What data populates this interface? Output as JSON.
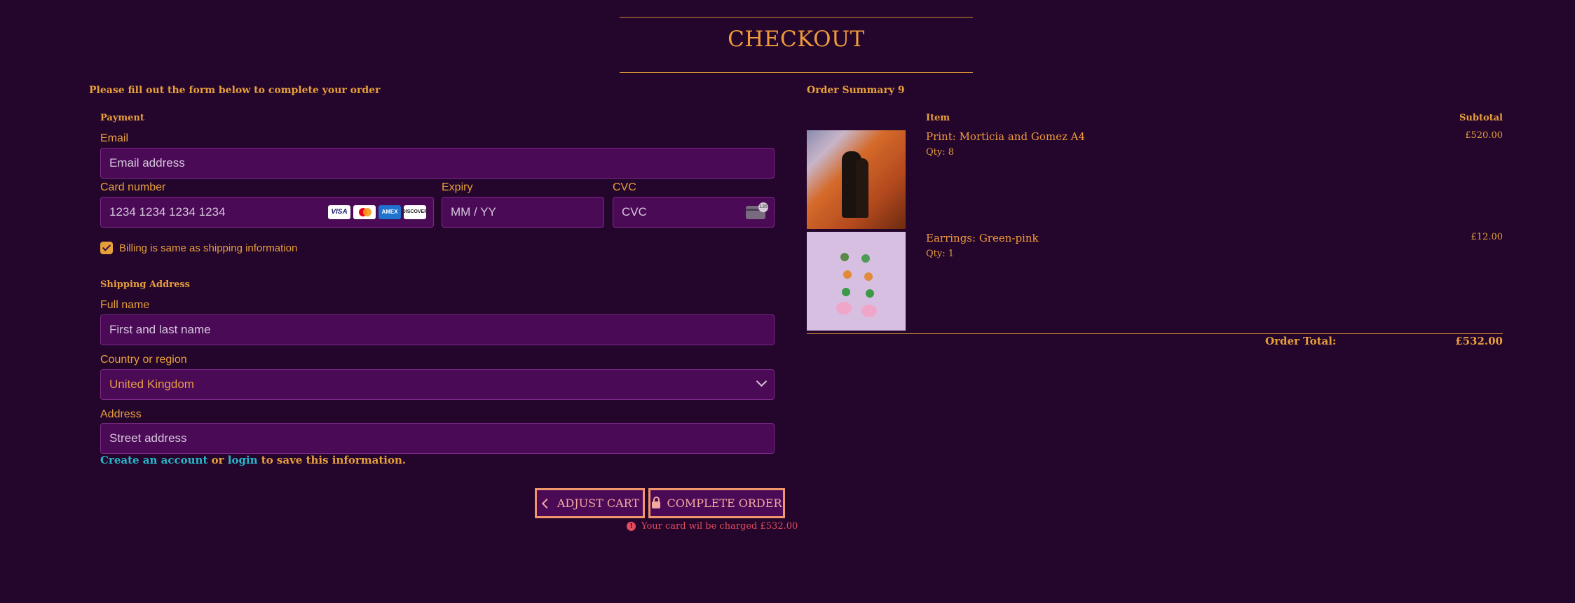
{
  "header": {
    "title": "CHECKOUT"
  },
  "form": {
    "intro": "Please fill out the form below to complete your order",
    "payment_heading": "Payment",
    "email": {
      "label": "Email",
      "placeholder": "Email address"
    },
    "card": {
      "label": "Card number",
      "placeholder": "1234 1234 1234 1234",
      "brands": [
        "VISA",
        "mastercard",
        "AMEX",
        "DISCOVER"
      ]
    },
    "expiry": {
      "label": "Expiry",
      "placeholder": "MM / YY"
    },
    "cvc": {
      "label": "CVC",
      "placeholder": "CVC",
      "icon_number": "135"
    },
    "billing_same": {
      "label": "Billing is same as shipping information",
      "checked": true
    },
    "shipping_heading": "Shipping Address",
    "full_name": {
      "label": "Full name",
      "placeholder": "First and last name"
    },
    "country": {
      "label": "Country or region",
      "value": "United Kingdom"
    },
    "address": {
      "label": "Address",
      "placeholder": "Street address"
    },
    "account_note": {
      "create": "Create an account",
      "or": " or ",
      "login": "login",
      "rest": " to save this information."
    }
  },
  "actions": {
    "adjust_cart": "ADJUST CART",
    "complete_order": "COMPLETE ORDER",
    "charge_note": "Your card wil be charged £532.00"
  },
  "summary": {
    "heading": "Order Summary 9",
    "col_item": "Item",
    "col_subtotal": "Subtotal",
    "items": [
      {
        "name": "Print: Morticia and Gomez A4",
        "qty": "Qty: 8",
        "subtotal": "£520.00"
      },
      {
        "name": "Earrings: Green-pink",
        "qty": "Qty: 1",
        "subtotal": "£12.00"
      }
    ],
    "total_label": "Order Total:",
    "total_value": "£532.00"
  },
  "colors": {
    "background": "#24052c",
    "accent": "#e6a03a",
    "field": "#4a0a56",
    "button_border": "#f0966c",
    "link": "#25b8c8",
    "warning": "#e14d5d"
  }
}
